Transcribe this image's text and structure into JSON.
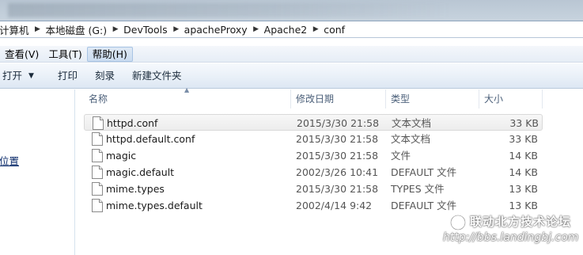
{
  "breadcrumb": [
    "计算机",
    "本地磁盘 (G:)",
    "DevTools",
    "apacheProxy",
    "Apache2",
    "conf"
  ],
  "menu": [
    "查看(V)",
    "工具(T)",
    "帮助(H)"
  ],
  "toolbar": {
    "open_label": "打开",
    "print_label": "打印",
    "burn_label": "刻录",
    "new_folder_label": "新建文件夹"
  },
  "navigation": {
    "location_label": "位置"
  },
  "columns": {
    "name": "名称",
    "modified": "修改日期",
    "type": "类型",
    "size": "大小"
  },
  "files": [
    {
      "name": "httpd.conf",
      "modified": "2015/3/30 21:58",
      "type": "文本文档",
      "size": "33 KB"
    },
    {
      "name": "httpd.default.conf",
      "modified": "2015/3/30 21:58",
      "type": "文本文档",
      "size": "33 KB"
    },
    {
      "name": "magic",
      "modified": "2015/3/30 21:58",
      "type": "文件",
      "size": "14 KB"
    },
    {
      "name": "magic.default",
      "modified": "2002/3/26 10:41",
      "type": "DEFAULT 文件",
      "size": "14 KB"
    },
    {
      "name": "mime.types",
      "modified": "2015/3/30 21:58",
      "type": "TYPES 文件",
      "size": "13 KB"
    },
    {
      "name": "mime.types.default",
      "modified": "2002/4/14 9:42",
      "type": "DEFAULT 文件",
      "size": "13 KB"
    }
  ],
  "watermark": {
    "title": "联动北方技术论坛",
    "url": "http://bbs.landingbj.com"
  },
  "icons": {
    "file": "document-icon",
    "watermark_logo": "forum-logo-icon"
  },
  "colors": {
    "selection_bg": "#ededed",
    "link": "#0a2a6a",
    "header_text": "#4c607a"
  }
}
